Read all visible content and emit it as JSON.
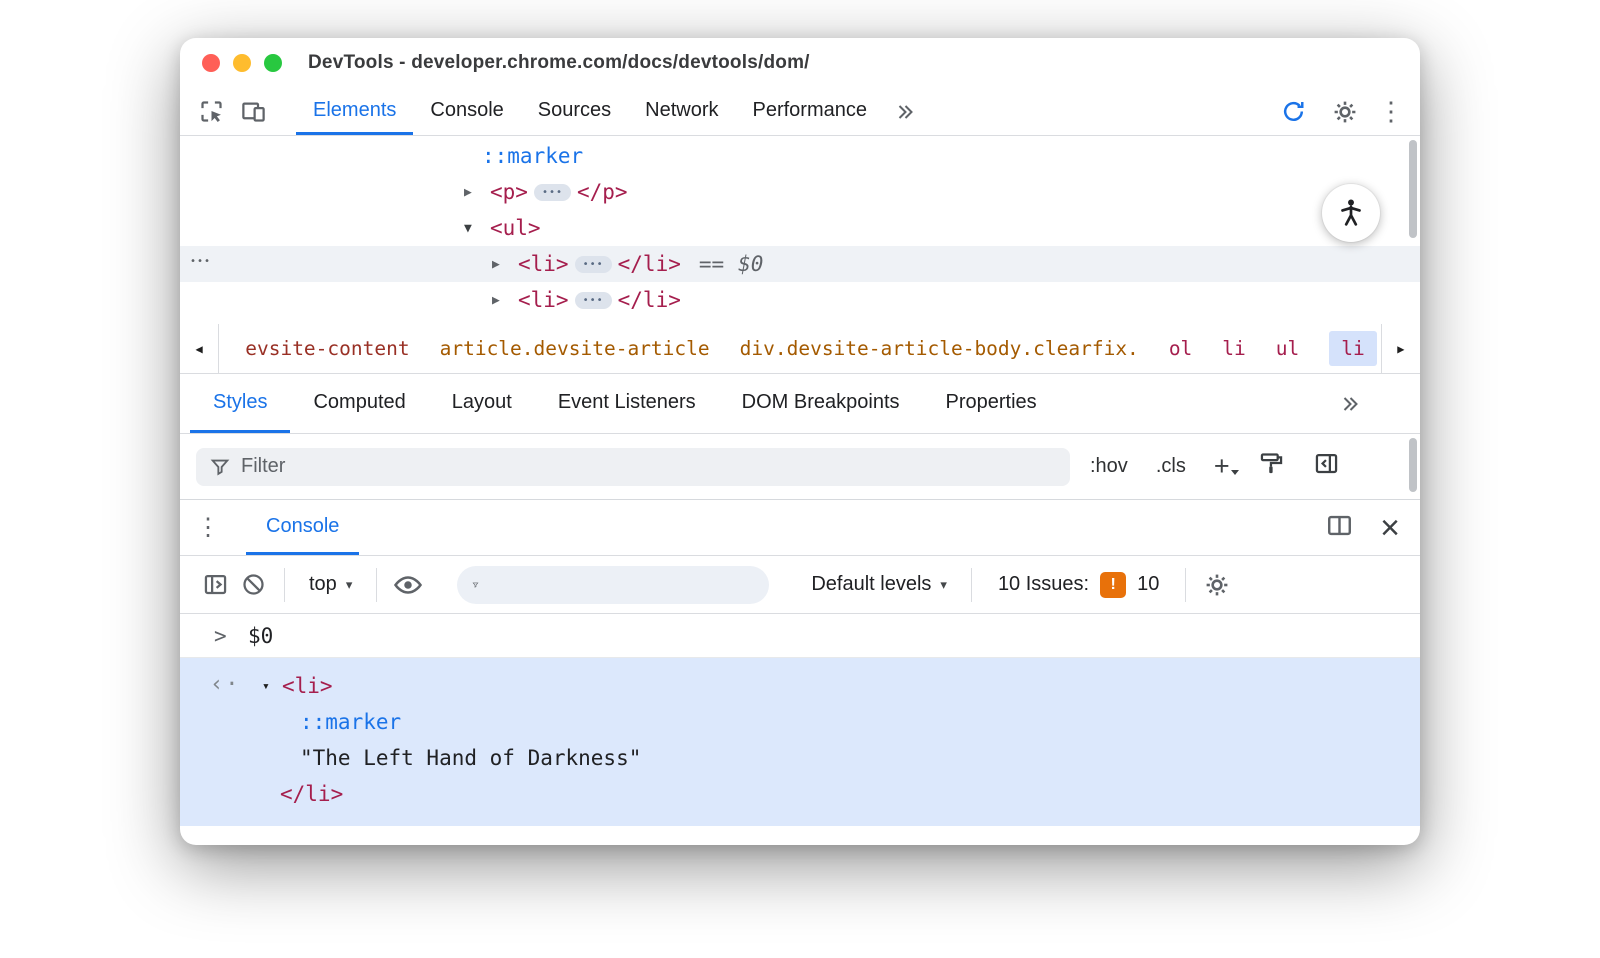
{
  "colors": {
    "accent_blue": "#1a73e8",
    "tag_red": "#A51E4D",
    "attr_orange": "#A45A00",
    "brick_red": "#993025",
    "issues_orange": "#E8710A",
    "result_selection_bg": "#DCE8FC",
    "breadcrumb_selected_bg": "#D5E2FB",
    "traffic_red": "#ff5f57",
    "traffic_yellow": "#febc2e",
    "traffic_green": "#28c840"
  },
  "icons": {
    "ellipsis": "•••",
    "gutter_dots": "•••",
    "kebab": "⋮",
    "close": "×",
    "caret_down": "▾",
    "twisty_collapsed": "▶",
    "twisty_expanded": "▼",
    "crumb_left": "◀",
    "crumb_right": "▶",
    "result_arrow": "‹·",
    "command_chevron": ">"
  },
  "titlebar": {
    "title": "DevTools - developer.chrome.com/docs/devtools/dom/"
  },
  "main_toolbar": {
    "tabs": [
      {
        "label": "Elements"
      },
      {
        "label": "Console"
      },
      {
        "label": "Sources"
      },
      {
        "label": "Network"
      },
      {
        "label": "Performance"
      }
    ]
  },
  "elements_panel": {
    "rows": [
      {
        "pseudo": "::marker"
      },
      {
        "open": "<p>",
        "close": "</p>"
      },
      {
        "open": "<ul>"
      },
      {
        "open": "<li>",
        "close": "</li>",
        "equals": "==",
        "ref": "$0"
      },
      {
        "open": "<li>",
        "close": "</li>"
      }
    ]
  },
  "breadcrumbs": {
    "items": [
      "evsite-content",
      "article.devsite-article",
      "div.devsite-article-body.clearfix.",
      "ol",
      "li",
      "ul",
      "li"
    ]
  },
  "styles_panel": {
    "tabs": [
      "Styles",
      "Computed",
      "Layout",
      "Event Listeners",
      "DOM Breakpoints",
      "Properties"
    ],
    "filter_placeholder": "Filter",
    "pseudo_toggle": ":hov",
    "class_toggle": ".cls",
    "new_rule": "+"
  },
  "console": {
    "tab": "Console",
    "context": "top",
    "levels": "Default levels",
    "issues_label": "10 Issues:",
    "issues_badge": "!",
    "issues_count": "10",
    "command": "$0",
    "result": {
      "open": "<li>",
      "pseudo": "::marker",
      "string": "\"The Left Hand of Darkness\"",
      "close": "</li>"
    }
  }
}
